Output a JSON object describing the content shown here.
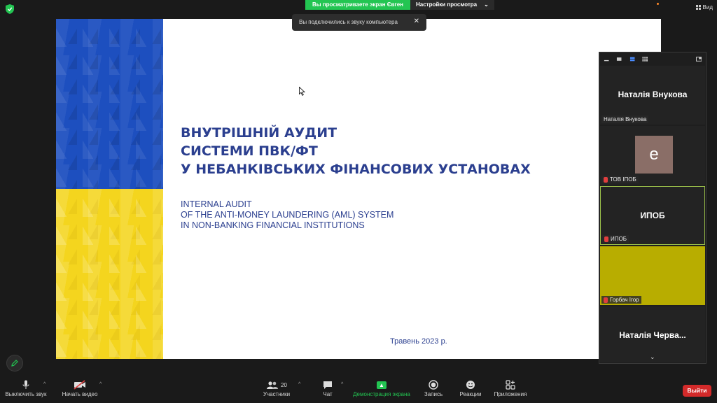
{
  "banner": {
    "viewing_text": "Вы просматриваете экран Євген",
    "view_settings": "Настройки просмотра"
  },
  "view_button": "Вид",
  "toast": "Вы подключились к звуку компьютера",
  "slide": {
    "title_ua": [
      "ВНУТРІШНІЙ АУДИТ",
      "СИСТЕМИ ПВК/ФТ",
      "У НЕБАНКІВСЬКИХ ФІНАНСОВИХ УСТАНОВАХ"
    ],
    "title_en": [
      "INTERNAL AUDIT",
      "OF THE ANTI-MONEY LAUNDERING (AML) SYSTEM",
      "IN NON-BANKING FINANCIAL INSTITUTIONS"
    ],
    "date": "Травень 2023 р.",
    "colors": {
      "flag_blue": "#1d4fbf",
      "flag_yellow": "#f4d51e",
      "title": "#2b3f8f"
    }
  },
  "participants": [
    {
      "big_name": "Наталія Внукова",
      "label": "Наталія Внукова",
      "muted": false
    },
    {
      "avatar_letter": "е",
      "label": "ТОВ ІПОБ",
      "muted": true
    },
    {
      "big_name": "ИПОБ",
      "label": "ИПОБ",
      "muted": true,
      "active": true
    },
    {
      "label": "Горбач Ігор",
      "muted": true,
      "video_color": "#b8ad00"
    },
    {
      "big_name": "Наталія Черва..."
    }
  ],
  "toolbar": {
    "mute": "Выключить звук",
    "video": "Начать видео",
    "participants": "Участники",
    "participants_count": "20",
    "chat": "Чат",
    "share": "Демонстрация экрана",
    "record": "Запись",
    "reactions": "Реакции",
    "apps": "Приложения",
    "leave": "Выйти"
  }
}
